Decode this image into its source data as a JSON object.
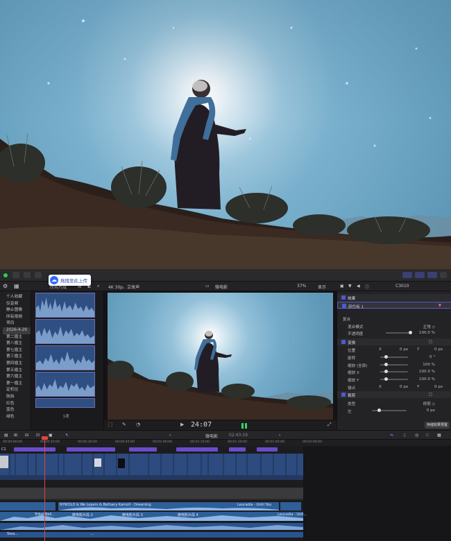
{
  "upload_badge": {
    "label": "拖拽至此上传",
    "icon": "cloud-upload-icon"
  },
  "browser_header": {
    "filter": "所有片段",
    "format": "4K 30p、立体声",
    "project": "微电影",
    "zoom": "37%",
    "view": "显示"
  },
  "sidebar": {
    "library_icon": "library-icon",
    "items": [
      "个人收藏",
      "仪音频",
      "静止图像",
      "所有视频",
      "项目",
      "2026-4-29",
      "第二循主",
      "第八循主",
      "第七循主",
      "第三循主",
      "第四循主",
      "第五循主",
      "第六循主",
      "第一循主",
      "定机位",
      "航拍",
      "红色",
      "蓝色",
      "绿色"
    ],
    "selected_index": 5
  },
  "browser": {
    "selection_count": "1项"
  },
  "viewer": {
    "timecode": "24:07"
  },
  "inspector": {
    "title": "C3010",
    "effects_header": "效果",
    "effect_name": "颜色板 1",
    "compositing": {
      "header": "复合",
      "blend_mode_label": "混合模式",
      "blend_mode_value": "正常 ◇",
      "opacity_label": "不透明度",
      "opacity_value": "100.0 %"
    },
    "transform": {
      "header": "变换",
      "rows": [
        {
          "label": "位置",
          "x_axis": "X",
          "x_value": "0 px",
          "y_axis": "Y",
          "y_value": "0 px"
        },
        {
          "label": "旋转",
          "value": "0 °"
        },
        {
          "label": "缩放 (全部)",
          "value": "100 %"
        },
        {
          "label": "缩放 X",
          "value": "100.0 %"
        },
        {
          "label": "缩放 Y",
          "value": "100.0 %"
        },
        {
          "label": "锚点",
          "x_axis": "X",
          "x_value": "0 px",
          "y_axis": "Y",
          "y_value": "0 px"
        }
      ]
    },
    "crop": {
      "header": "裁剪",
      "type_label": "类型",
      "type_value": "修剪 ◇",
      "left_label": "左",
      "left_value": "0 px"
    },
    "save_button": "存储效果预置"
  },
  "timeline": {
    "project_name": "微电影",
    "duration": "02:43:19",
    "ruler_ticks": [
      "00:00:00:00",
      "00:00:15:00",
      "00:00:30:00",
      "00:00:45:00",
      "00:01:00:00",
      "00:01:15:00",
      "00:01:30:00",
      "00:01:45:00",
      "00:02:00:00"
    ],
    "music_clip_a": "NYWOLD & We Lepers & Bethany Karnoll - Dreaming",
    "music_clip_b": "Leucadia - Until You",
    "music_clip_c": "Leucadia - Unti...",
    "audio_clip_1": "Tribal Bell...",
    "audio_clip_2": "微电影片段 2",
    "audio_clip_3": "微电影片段 3",
    "audio_clip_4": "微电影片段 4",
    "audio_clip_5": "Stea...",
    "audio_clip_6": "...",
    "clip_start_label": "C1"
  },
  "colors": {
    "accent": "#5c5fd9",
    "clip_blue": "#2d4b7e",
    "clip_purple": "#6a4cc9",
    "playhead": "#e2443c",
    "audio_blue": "#2e5f99"
  }
}
